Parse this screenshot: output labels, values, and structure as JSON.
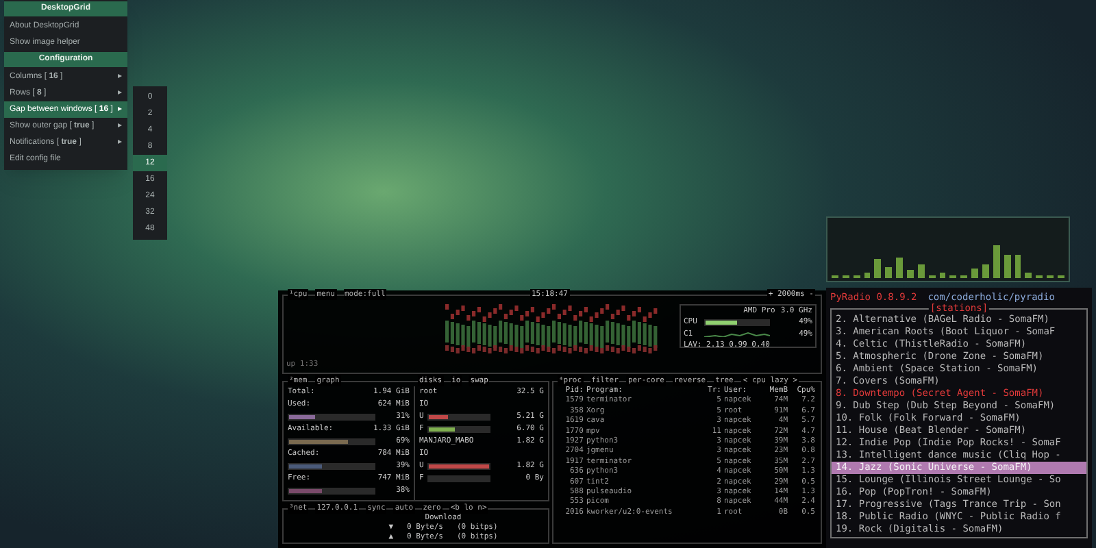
{
  "menu": {
    "items": [
      {
        "kind": "title",
        "label": "DesktopGrid",
        "selected": false
      },
      {
        "kind": "action",
        "label": "About DesktopGrid",
        "selected": false
      },
      {
        "kind": "action",
        "label": "Show image helper",
        "selected": false
      },
      {
        "kind": "title",
        "label": "Configuration",
        "selected": false
      },
      {
        "kind": "submenu",
        "label": "Columns [ **16** ]",
        "arrow": "▸",
        "selected": false
      },
      {
        "kind": "submenu",
        "label": "Rows [ **8** ]",
        "arrow": "▸",
        "selected": false
      },
      {
        "kind": "submenu",
        "label": "Gap between windows [ **16** ]",
        "arrow": "▸",
        "selected": true
      },
      {
        "kind": "submenu",
        "label": "Show outer gap [ **true** ]",
        "arrow": "▸",
        "selected": false
      },
      {
        "kind": "submenu",
        "label": "Notifications [ **true** ]",
        "arrow": "▸",
        "selected": false
      },
      {
        "kind": "action",
        "label": "Edit config file",
        "selected": false
      }
    ]
  },
  "submenu": {
    "items": [
      {
        "label": "0",
        "selected": false
      },
      {
        "label": "2",
        "selected": false
      },
      {
        "label": "4",
        "selected": false
      },
      {
        "label": "8",
        "selected": false
      },
      {
        "label": "12",
        "selected": true
      },
      {
        "label": "16",
        "selected": false
      },
      {
        "label": "24",
        "selected": false
      },
      {
        "label": "32",
        "selected": false
      },
      {
        "label": "48",
        "selected": false
      }
    ]
  },
  "btop": {
    "cpu_box": {
      "tabs": [
        "¹cpu",
        "menu",
        "mode:full"
      ],
      "time": "15:18:47",
      "interval": "+ 2000ms -",
      "uptime": "up 1:33",
      "model": "AMD Pro",
      "freq": "3.0 GHz",
      "meters": [
        {
          "kind": "bar",
          "label": "CPU",
          "level": 0.49,
          "reading": "49%"
        },
        {
          "kind": "graph",
          "label": "C1",
          "reading": "49%"
        }
      ],
      "load": "LAV: 2.13 0.99 0.40"
    },
    "mem_box": {
      "tabs": [
        "²mem",
        "graph"
      ],
      "rows": [
        {
          "kind": "value",
          "label": "Total:",
          "value": "1.94 GiB"
        },
        {
          "kind": "value",
          "label": "Used:",
          "value": "624 MiB"
        },
        {
          "kind": "meter",
          "level": 0.31,
          "reading": "31%",
          "color": "#8a6a9a"
        },
        {
          "kind": "value",
          "label": "Available:",
          "value": "1.33 GiB"
        },
        {
          "kind": "meter",
          "level": 0.69,
          "reading": "69%",
          "color": "#7a6a50"
        },
        {
          "kind": "value",
          "label": "Cached:",
          "value": "784 MiB"
        },
        {
          "kind": "meter",
          "level": 0.39,
          "reading": "39%",
          "color": "#4a5a7a"
        },
        {
          "kind": "value",
          "label": "Free:",
          "value": "747 MiB"
        },
        {
          "kind": "meter",
          "level": 0.38,
          "reading": "38%",
          "color": "#7a4a6a"
        }
      ]
    },
    "disks_box": {
      "tabs": [
        "disks",
        "io",
        "swap"
      ],
      "rows": [
        {
          "kind": "disk",
          "label": "root",
          "value": "32.5 G"
        },
        {
          "kind": "io",
          "label": "IO"
        },
        {
          "kind": "meter",
          "label": "U",
          "level": 0.3,
          "reading": "5.21 G",
          "color": "#c04848"
        },
        {
          "kind": "meter",
          "label": "F",
          "level": 0.42,
          "reading": "6.70 G",
          "color": "#80b050"
        },
        {
          "kind": "disk",
          "label": "MANJARO_MABO",
          "value": "1.82 G"
        },
        {
          "kind": "io",
          "label": "IO"
        },
        {
          "kind": "meter",
          "label": "U",
          "level": 1.0,
          "reading": "1.82 G",
          "color": "#c04848"
        },
        {
          "kind": "meter",
          "label": "F",
          "reading": "0 By"
        }
      ]
    },
    "net_box": {
      "tabs": [
        "³net",
        "127.0.0.1",
        "sync",
        "auto",
        "zero",
        "<b lo n>"
      ],
      "title": "Download",
      "rows": [
        {
          "arrow": "▼",
          "rate": "0 Byte/s",
          "bits": "(0 bitps)"
        },
        {
          "arrow": "▲",
          "rate": "0 Byte/s",
          "bits": "(0 bitps)"
        }
      ]
    },
    "proc_box": {
      "tabs": [
        "⁴proc",
        "filter",
        "per-core",
        "reverse",
        "tree",
        "< cpu lazy >"
      ],
      "columns": [
        "Pid:",
        "Program:",
        "Tr:",
        "User:",
        "MemB",
        "Cpu%"
      ],
      "rows": [
        [
          "1579",
          "terminator",
          "5",
          "napcek",
          "74M",
          "7.2"
        ],
        [
          "358",
          "Xorg",
          "5",
          "root",
          "91M",
          "6.7"
        ],
        [
          "1619",
          "cava",
          "3",
          "napcek",
          "4M",
          "5.7"
        ],
        [
          "1770",
          "mpv",
          "11",
          "napcek",
          "72M",
          "4.7"
        ],
        [
          "1927",
          "python3",
          "3",
          "napcek",
          "39M",
          "3.8"
        ],
        [
          "2704",
          "jgmenu",
          "3",
          "napcek",
          "23M",
          "0.8"
        ],
        [
          "1917",
          "terminator",
          "5",
          "napcek",
          "35M",
          "2.7"
        ],
        [
          "636",
          "python3",
          "4",
          "napcek",
          "50M",
          "1.3"
        ],
        [
          "607",
          "tint2",
          "2",
          "napcek",
          "29M",
          "0.5"
        ],
        [
          "588",
          "pulseaudio",
          "3",
          "napcek",
          "14M",
          "1.3"
        ],
        [
          "553",
          "picom",
          "8",
          "napcek",
          "44M",
          "2.4"
        ],
        [
          "2016",
          "kworker/u2:0-events",
          "1",
          "root",
          "0B",
          "0.5"
        ]
      ]
    }
  },
  "pyradio": {
    "title": "PyRadio 0.8.9.2",
    "url": "com/coderholic/pyradio",
    "list_title": "[stations]",
    "stations": [
      {
        "text": "2. Alternative (BAGeL Radio - SomaFM)",
        "playing": false,
        "selected": false
      },
      {
        "text": "3. American Roots (Boot Liquor - SomaF",
        "playing": false,
        "selected": false
      },
      {
        "text": "4. Celtic (ThistleRadio - SomaFM)",
        "playing": false,
        "selected": false
      },
      {
        "text": "5. Atmospheric (Drone Zone - SomaFM)",
        "playing": false,
        "selected": false
      },
      {
        "text": "6. Ambient (Space Station - SomaFM)",
        "playing": false,
        "selected": false
      },
      {
        "text": "7. Covers (SomaFM)",
        "playing": false,
        "selected": false
      },
      {
        "text": "8. Downtempo (Secret Agent - SomaFM)",
        "playing": true,
        "selected": false
      },
      {
        "text": "9. Dub Step (Dub Step Beyond - SomaFM)",
        "playing": false,
        "selected": false
      },
      {
        "text": "10. Folk (Folk Forward - SomaFM)",
        "playing": false,
        "selected": false
      },
      {
        "text": "11. House (Beat Blender - SomaFM)",
        "playing": false,
        "selected": false
      },
      {
        "text": "12. Indie Pop (Indie Pop Rocks! - SomaF",
        "playing": false,
        "selected": false
      },
      {
        "text": "13. Intelligent dance music (Cliq Hop -",
        "playing": false,
        "selected": false
      },
      {
        "text": "14. Jazz (Sonic Universe - SomaFM)",
        "playing": false,
        "selected": true
      },
      {
        "text": "15. Lounge (Illinois Street Lounge - So",
        "playing": false,
        "selected": false
      },
      {
        "text": "16. Pop (PopTron! - SomaFM)",
        "playing": false,
        "selected": false
      },
      {
        "text": "17. Progressive (Tags Trance Trip - Son",
        "playing": false,
        "selected": false
      },
      {
        "text": "18. Public Radio (WNYC - Public Radio f",
        "playing": false,
        "selected": false
      },
      {
        "text": "19. Rock (Digitalis - SomaFM)",
        "playing": false,
        "selected": false
      }
    ]
  }
}
